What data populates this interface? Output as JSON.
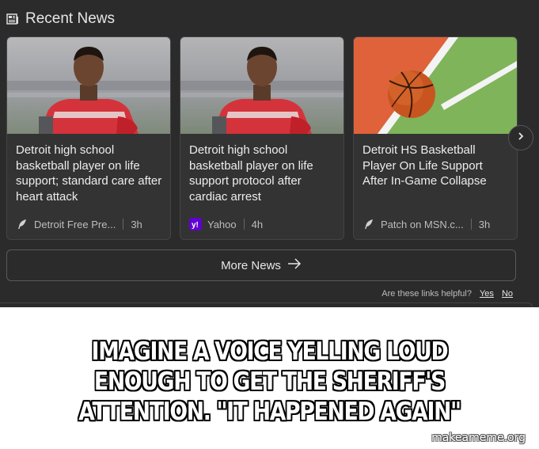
{
  "header": {
    "title": "Recent News",
    "icon": "newspaper-icon"
  },
  "cards": [
    {
      "headline": "Detroit high school basketball player on life support; standard care after heart attack",
      "source": "Detroit Free Pre...",
      "time": "3h",
      "source_icon": "feather-icon"
    },
    {
      "headline": "Detroit high school basketball player on life support protocol after cardiac arrest",
      "source": "Yahoo",
      "time": "4h",
      "source_icon": "yahoo-icon"
    },
    {
      "headline": "Detroit HS Basketball Player On Life Support After In-Game Collapse",
      "source": "Patch on MSN.c...",
      "time": "3h",
      "source_icon": "feather-icon"
    }
  ],
  "next_button": {
    "icon": "chevron-right-icon"
  },
  "more_news": {
    "label": "More News",
    "icon": "arrow-right-icon"
  },
  "feedback": {
    "question": "Are these links helpful?",
    "yes": "Yes",
    "no": "No"
  },
  "caption": "IMAGINE A VOICE YELLING LOUD ENOUGH TO GET THE SHERIFF'S ATTENTION. \"IT HAPPENED AGAIN\"",
  "watermark": "makeameme.org",
  "colors": {
    "panel_bg": "#2b2b2b",
    "card_bg": "#333333",
    "court_orange": "#e0623a",
    "court_green": "#7fb45a"
  }
}
